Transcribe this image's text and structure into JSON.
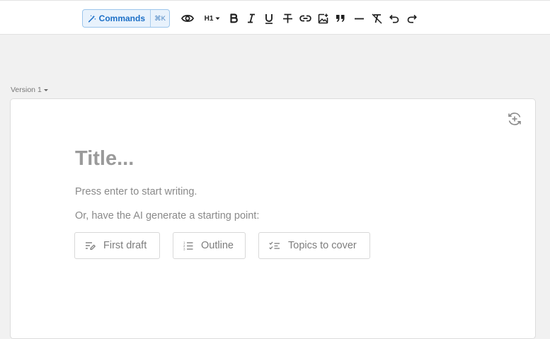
{
  "toolbar": {
    "commands_label": "Commands",
    "commands_shortcut": "⌘K",
    "heading_label": "H1"
  },
  "editor": {
    "version_label": "Version 1",
    "title_placeholder": "Title...",
    "hint_start": "Press enter to start writing.",
    "hint_ai": "Or, have the AI generate a starting point:",
    "buttons": [
      {
        "label": "First draft",
        "icon": "pencil-lines-icon"
      },
      {
        "label": "Outline",
        "icon": "numbered-list-icon"
      },
      {
        "label": "Topics to cover",
        "icon": "checklist-icon"
      }
    ]
  },
  "colors": {
    "accent": "#1b6fc7",
    "accent_bg": "#e8f2fc",
    "page_bg": "#f1f1f1",
    "placeholder": "#9a9a9a"
  }
}
